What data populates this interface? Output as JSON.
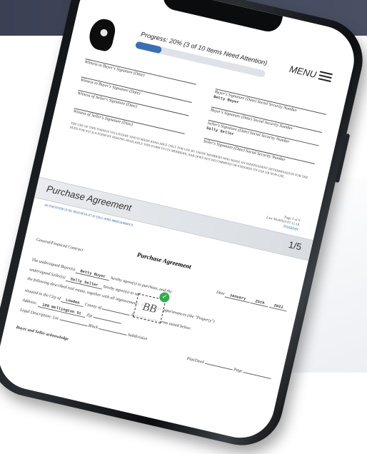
{
  "header": {
    "progress_text": "Progress: 20% (3 of 10 Items Need Attention)",
    "progress_percent": 20,
    "menu_label": "MENU"
  },
  "signatures": {
    "buyer_witness_1": "Witness to Buyer's Signature (Date)",
    "buyer_sig_1": "Buyer's Signature (Date) Social Security Number",
    "buyer_name": "Betty Buyer",
    "buyer_witness_2": "Witness to Buyer's Signature (Date)",
    "buyer_sig_2": "Buyer's Signature (Date) Social Security Number",
    "seller_witness_1": "Witness of Seller's Signature (Date)",
    "seller_sig_1": "Seller's Signature (Date) Social Security Number",
    "seller_name": "Sally Seller",
    "seller_witness_2": "Witness of Seller's Signature (Date)",
    "seller_sig_2": "Seller's Signature (Date) Social Security Number",
    "disclaimer": "The use of this form is voluntary and is made available only for use by those members who make an independent determination for the need for such a form by making available this form to its members, AAR does not recommend or endorse its use or non-use."
  },
  "page_info": {
    "page": "Page 5 of 9",
    "modified": "Last Modified 07.11.18",
    "brand": "Instanet"
  },
  "section": {
    "title": "Purchase Agreement",
    "pages": "1/5"
  },
  "reference": "Authentisign ID: 8D1F4F3A-E71F-E811-A965-000D3A0060C8",
  "agreement": {
    "title": "Purchase Agreement",
    "contract_type": "General/Financed Contract",
    "date_label": "Date",
    "date_month": "January",
    "date_day": "25th",
    "date_year": "2021",
    "buyer_label": "The undersigned Buyer(s)",
    "buyer_value": "Betty Buyer",
    "buyer_suffix": "hereby agree(s) to purchase, and the",
    "seller_label": "undersigned Seller(s)",
    "seller_value": "Sally Seller",
    "seller_suffix": "hereby agree(s) to sell",
    "property_text": "the following described real estate, together with all improvements,",
    "property_suffix": "fixtures and appurtenances (the \"Property\")",
    "city_label": "situated in the City of",
    "city_value": "Lowden",
    "county_label": "County of",
    "state_text": "Alabama, to the terms stated below:",
    "address_label": "Address:",
    "address_value": "109 Wellington St",
    "zip_label": "Zip",
    "legal_label": "Legal Description: Lot",
    "block_label": "Block",
    "subdivision_label": "Subdivision",
    "plat_label": "Plat/Deed",
    "page_label": "Page",
    "ack_text": "Buyer and Seller acknowledge"
  },
  "initials_text": "BB",
  "colors": {
    "progress_fill": "#3a6fb5",
    "check": "#2fae4d",
    "top_band": "#3b4053"
  }
}
